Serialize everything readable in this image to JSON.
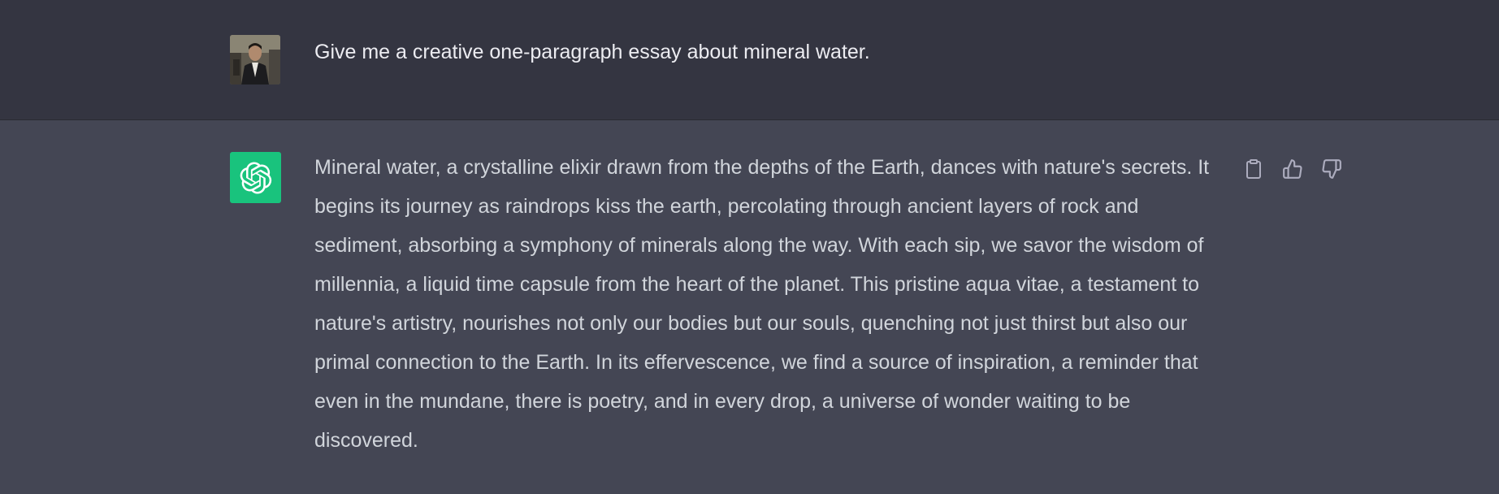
{
  "conversation": {
    "user_message": {
      "text": "Give me a creative one-paragraph essay about mineral water."
    },
    "assistant_message": {
      "text": "Mineral water, a crystalline elixir drawn from the depths of the Earth, dances with nature's secrets. It begins its journey as raindrops kiss the earth, percolating through ancient layers of rock and sediment, absorbing a symphony of minerals along the way. With each sip, we savor the wisdom of millennia, a liquid time capsule from the heart of the planet. This pristine aqua vitae, a testament to nature's artistry, nourishes not only our bodies but our souls, quenching not just thirst but also our primal connection to the Earth. In its effervescence, we find a source of inspiration, a reminder that even in the mundane, there is poetry, and in every drop, a universe of wonder waiting to be discovered.",
      "actions": [
        "clipboard-icon",
        "thumbs-up-icon",
        "thumbs-down-icon"
      ]
    }
  },
  "colors": {
    "user_row_bg": "#343541",
    "assistant_row_bg": "#444654",
    "gpt_avatar_bg": "#19c37d",
    "icon_color": "#acacbe"
  }
}
